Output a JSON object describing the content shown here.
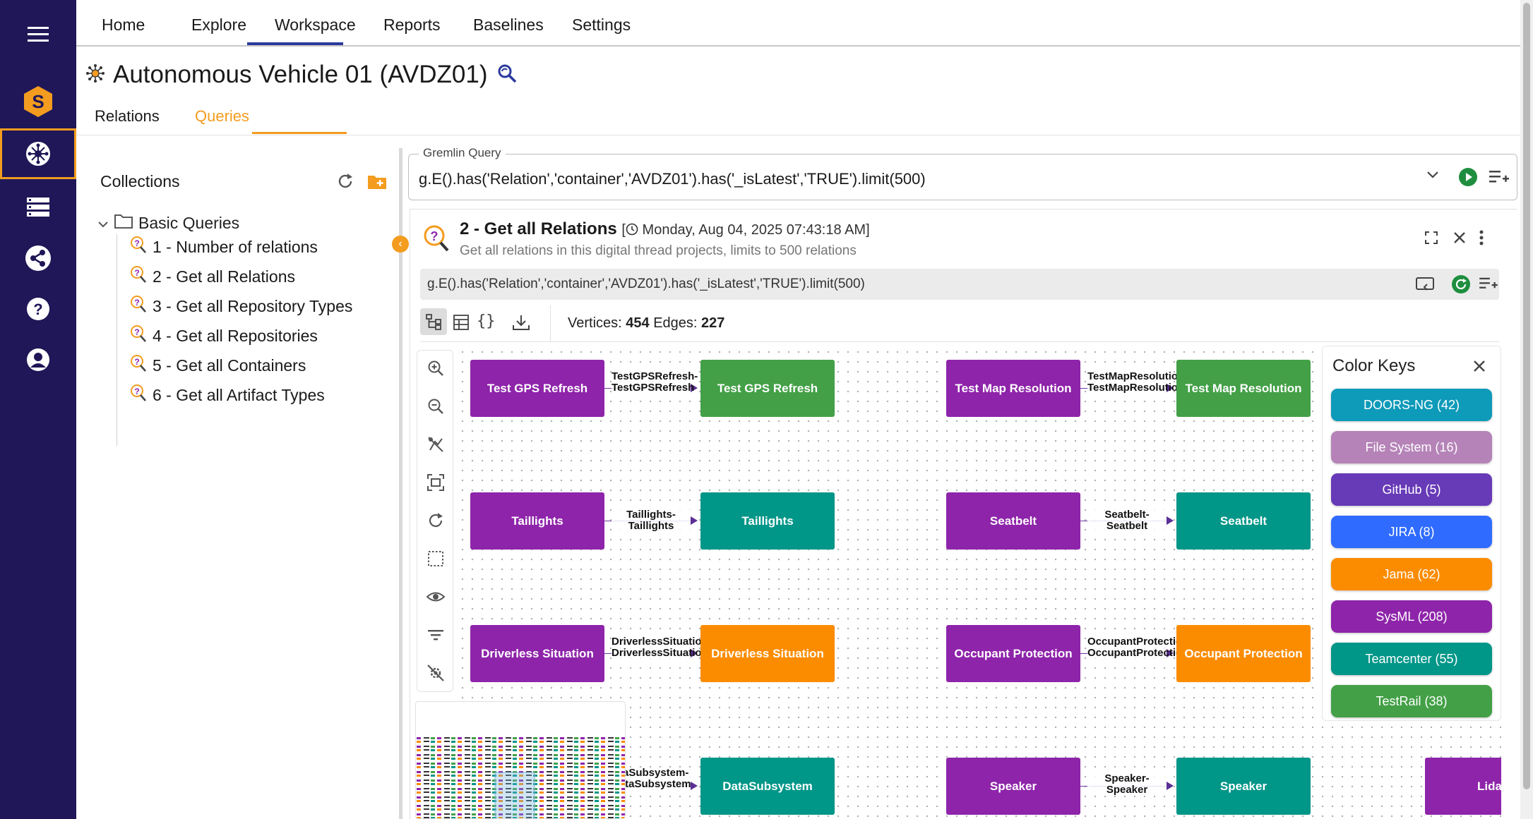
{
  "nav_tabs": [
    "Home",
    "Explore",
    "Workspace",
    "Reports",
    "Baselines",
    "Settings"
  ],
  "page": {
    "title": "Autonomous Vehicle 01 (AVDZ01)",
    "sub_tabs": [
      "Relations",
      "Queries"
    ]
  },
  "collections": {
    "title": "Collections",
    "folder": "Basic Queries",
    "items": [
      "1 - Number of relations",
      "2 - Get all Relations",
      "3 - Get all Repository Types",
      "4 - Get all Repositories",
      "5 - Get all Containers",
      "6 - Get all Artifact Types"
    ]
  },
  "gremlin": {
    "label": "Gremlin Query",
    "value": "g.E().has('Relation','container','AVDZ01').has('_isLatest','TRUE').limit(500)"
  },
  "result": {
    "title": "2 - Get all Relations",
    "date": "Monday, Aug 04, 2025 07:43:18 AM",
    "description": "Get all relations in this digital thread projects, limits to 500 relations",
    "query": "g.E().has('Relation','container','AVDZ01').has('_isLatest','TRUE').limit(500)",
    "vertices_label": "Vertices:",
    "vertices": "454",
    "edges_label": "Edges:",
    "edges": "227"
  },
  "graph": {
    "nodes": [
      {
        "label": "Test GPS Refresh",
        "color": "#8e24aa"
      },
      {
        "label": "Test GPS Refresh",
        "color": "#43a047"
      },
      {
        "label": "Test Map Resolution",
        "color": "#8e24aa"
      },
      {
        "label": "Test Map Resolution",
        "color": "#43a047"
      },
      {
        "label": "Taillights",
        "color": "#8e24aa"
      },
      {
        "label": "Taillights",
        "color": "#009688"
      },
      {
        "label": "Seatbelt",
        "color": "#8e24aa"
      },
      {
        "label": "Seatbelt",
        "color": "#009688"
      },
      {
        "label": "Driverless Situation",
        "color": "#8e24aa"
      },
      {
        "label": "Driverless Situation",
        "color": "#fb8c00"
      },
      {
        "label": "Occupant Protection",
        "color": "#8e24aa"
      },
      {
        "label": "Occupant Protection",
        "color": "#fb8c00"
      },
      {
        "label": "DataSubsystem",
        "color": "#009688"
      },
      {
        "label": "Speaker",
        "color": "#8e24aa"
      },
      {
        "label": "Speaker",
        "color": "#009688"
      },
      {
        "label": "Lida",
        "color": "#8e24aa"
      }
    ],
    "edge_labels": [
      "TestGPSRefresh-TestGPSRefresh",
      "TestMapResolution-TestMapResolution",
      "Taillights-Taillights",
      "Seatbelt-Seatbelt",
      "DriverlessSituation-DriverlessSituation",
      "OccupantProtection-OccupantProtection",
      "ataSubsystem-DataSubsystem",
      "Speaker-Speaker"
    ]
  },
  "color_keys": {
    "title": "Color Keys",
    "items": [
      {
        "label": "DOORS-NG (42)",
        "color": "#0e9ab9"
      },
      {
        "label": "File System (16)",
        "color": "#b583b8"
      },
      {
        "label": "GitHub (5)",
        "color": "#673ab7"
      },
      {
        "label": "JIRA (8)",
        "color": "#2f6bff"
      },
      {
        "label": "Jama (62)",
        "color": "#fb8c00"
      },
      {
        "label": "SysML (208)",
        "color": "#8e24aa"
      },
      {
        "label": "Teamcenter (55)",
        "color": "#009688"
      },
      {
        "label": "TestRail (38)",
        "color": "#43a047"
      }
    ]
  },
  "icons": [
    "menu-icon",
    "logo-icon",
    "explore-icon",
    "storage-icon",
    "share-icon",
    "help-icon",
    "account-icon"
  ]
}
